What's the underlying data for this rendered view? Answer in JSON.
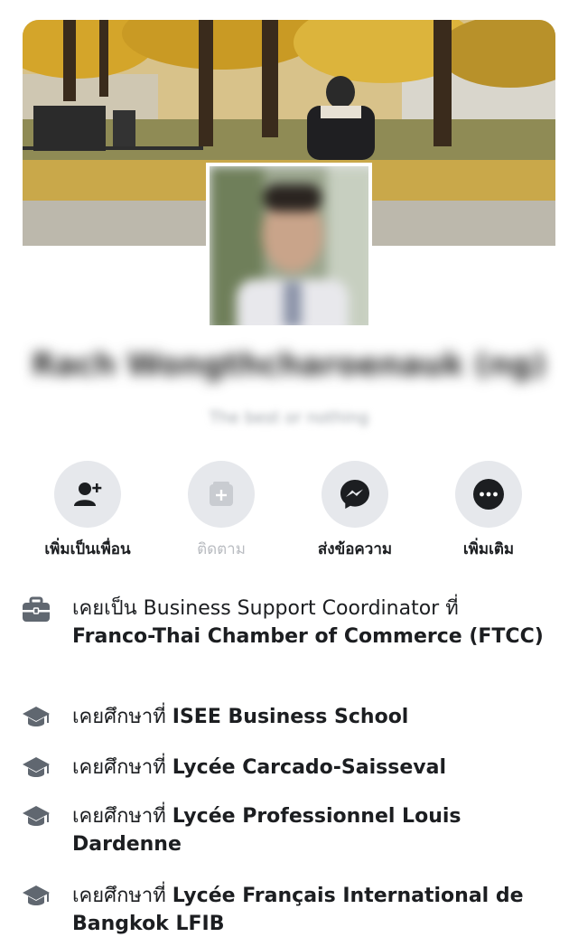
{
  "profile": {
    "name": "Rach Wongthcharoenauk (ng)",
    "bio": "The best or nothing"
  },
  "actions": [
    {
      "label": "เพิ่มเป็นเพื่อน",
      "icon": "add-friend-icon"
    },
    {
      "label": "ติดตาม",
      "icon": "follow-icon",
      "disabled": true
    },
    {
      "label": "ส่งข้อความ",
      "icon": "messenger-icon"
    },
    {
      "label": "เพิ่มเติม",
      "icon": "more-icon"
    }
  ],
  "about": {
    "work": {
      "prefix": "เคยเป็น",
      "role": "Business Support Coordinator",
      "at": "ที่",
      "company": "Franco-Thai Chamber of Commerce (FTCC)",
      "icon": "briefcase-icon"
    },
    "education": [
      {
        "prefix": "เคยศึกษาที่",
        "school": "ISEE Business School",
        "icon": "graduation-cap-icon"
      },
      {
        "prefix": "เคยศึกษาที่",
        "school": "Lycée Carcado-Saisseval",
        "icon": "graduation-cap-icon"
      },
      {
        "prefix": "เคยศึกษาที่",
        "school": "Lycée Professionnel Louis Dardenne",
        "icon": "graduation-cap-icon"
      },
      {
        "prefix": "เคยศึกษาที่",
        "school": "Lycée Français International de Bangkok LFIB",
        "icon": "graduation-cap-icon"
      }
    ]
  },
  "colors": {
    "icon_bg": "#e6e8ec",
    "text": "#1c1e21",
    "muted": "#b9bcc1",
    "info_icon": "#606770"
  }
}
